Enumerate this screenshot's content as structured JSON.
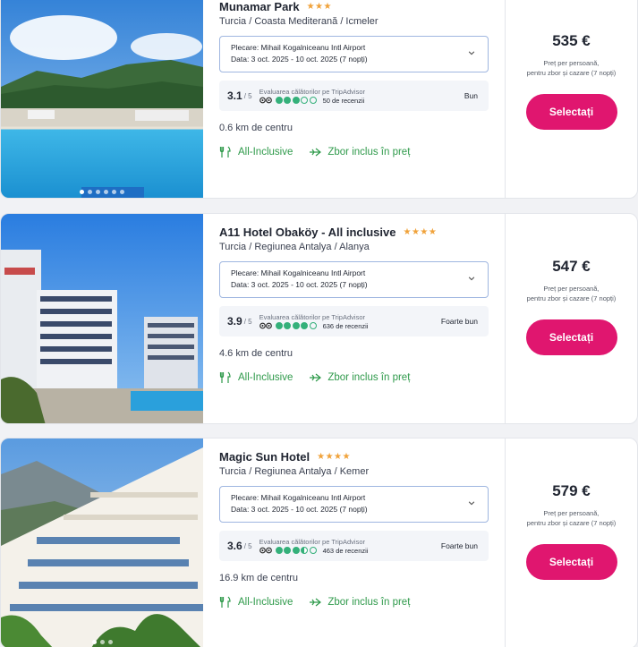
{
  "hotels": [
    {
      "name": "Munamar Park",
      "stars": "★★★",
      "location": "Turcia / Coasta Mediterană / Icmeler",
      "departure": "Plecare: Mihail Kogalniceanu Intl Airport",
      "dates": "Data: 3 oct. 2025 - 10 oct. 2025 (7 nopți)",
      "score": "3.1",
      "score_max": "/ 5",
      "rating_label": "Evaluarea călătorilor pe TripAdvisor",
      "bubbles_filled": 3,
      "reviews": "50 de recenzii",
      "verdict": "Bun",
      "distance": "0.6 km de centru",
      "feature_board": "All-Inclusive",
      "feature_flight": "Zbor inclus în preț",
      "price": "535 €",
      "price_note_1": "Preț per persoană,",
      "price_note_2": "pentru zbor și cazare (7 nopți)",
      "select_label": "Selectați"
    },
    {
      "name": "A11 Hotel Obaköy - All inclusive",
      "stars": "★★★★",
      "location": "Turcia / Regiunea Antalya / Alanya",
      "departure": "Plecare: Mihail Kogalniceanu Intl Airport",
      "dates": "Data: 3 oct. 2025 - 10 oct. 2025 (7 nopți)",
      "score": "3.9",
      "score_max": "/ 5",
      "rating_label": "Evaluarea călătorilor pe TripAdvisor",
      "bubbles_filled": 4,
      "reviews": "636 de recenzii",
      "verdict": "Foarte bun",
      "distance": "4.6 km de centru",
      "feature_board": "All-Inclusive",
      "feature_flight": "Zbor inclus în preț",
      "price": "547 €",
      "price_note_1": "Preț per persoană,",
      "price_note_2": "pentru zbor și cazare (7 nopți)",
      "select_label": "Selectați"
    },
    {
      "name": "Magic Sun Hotel",
      "stars": "★★★★",
      "location": "Turcia / Regiunea Antalya / Kemer",
      "departure": "Plecare: Mihail Kogalniceanu Intl Airport",
      "dates": "Data: 3 oct. 2025 - 10 oct. 2025 (7 nopți)",
      "score": "3.6",
      "score_max": "/ 5",
      "rating_label": "Evaluarea călătorilor pe TripAdvisor",
      "bubbles_filled": 3.5,
      "reviews": "463 de recenzii",
      "verdict": "Foarte bun",
      "distance": "16.9 km de centru",
      "feature_board": "All-Inclusive",
      "feature_flight": "Zbor inclus în preț",
      "price": "579 €",
      "price_note_1": "Preț per persoană,",
      "price_note_2": "pentru zbor și cazare (7 nopți)",
      "select_label": "Selectați"
    }
  ],
  "colors": {
    "accent": "#e0166f",
    "green": "#2f9a4b",
    "tripadvisor": "#34b07a",
    "star": "#f0a23a"
  },
  "icons": [
    "chevron-down-icon",
    "tripadvisor-icon",
    "all-inclusive-icon",
    "flight-icon"
  ]
}
